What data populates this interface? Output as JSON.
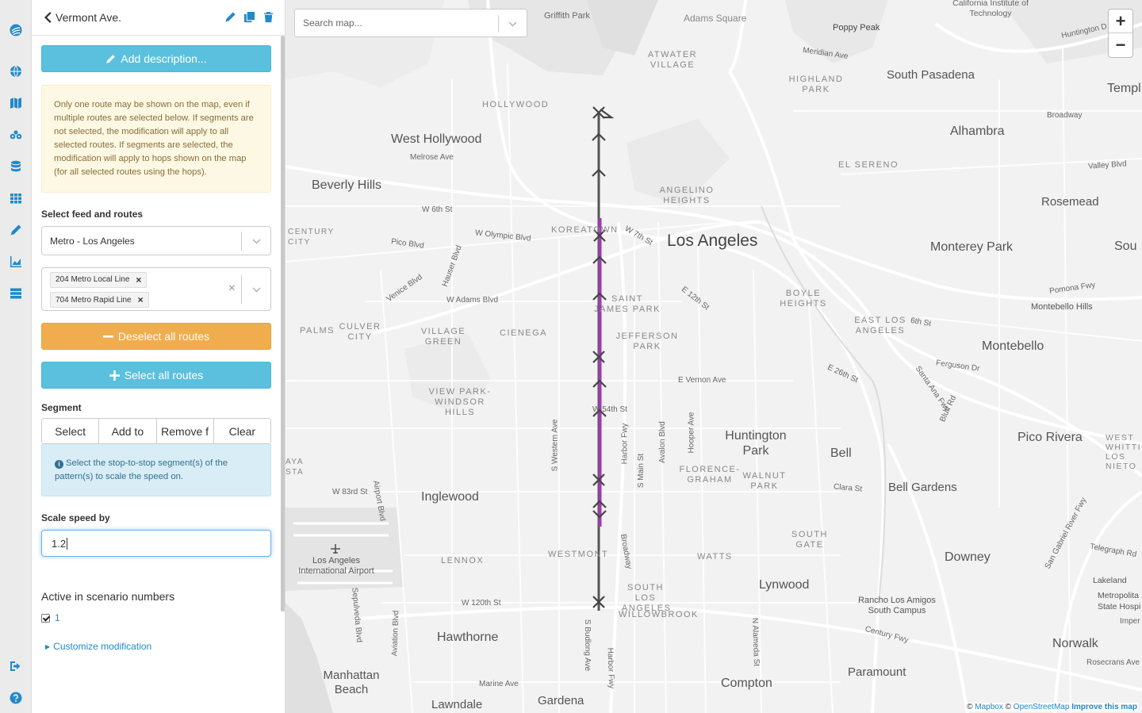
{
  "rail": {
    "icons": [
      "logo-icon",
      "globe-icon",
      "map-icon",
      "bike-network-icon",
      "database-icon",
      "grid-icon",
      "pencil-icon",
      "chart-icon",
      "server-icon",
      "logout-icon",
      "help-icon"
    ]
  },
  "panel": {
    "title": "Vermont Ave.",
    "add_description": "Add description...",
    "warning": "Only one route may be shown on the map, even if multiple routes are selected below. If segments are not selected, the modification will apply to all selected routes. If segments are selected, the modification will apply to hops shown on the map (for all selected routes using the hops).",
    "feed_label": "Select feed and routes",
    "feed_value": "Metro - Los Angeles",
    "routes": [
      "204 Metro Local Line",
      "704 Metro Rapid Line"
    ],
    "deselect_all": "Deselect all routes",
    "select_all": "Select all routes",
    "segment_label": "Segment",
    "segment_buttons": [
      "Select",
      "Add to",
      "Remove f",
      "Clear"
    ],
    "segment_help": "Select the stop-to-stop segment(s) of the pattern(s) to scale the speed on.",
    "scale_label": "Scale speed by",
    "scale_value": "1.2",
    "scenario_label": "Active in scenario numbers",
    "scenario_value": "1",
    "customize": "Customize modification"
  },
  "map": {
    "search_placeholder": "Search map...",
    "zoom_in": "+",
    "zoom_out": "−",
    "attribution": {
      "prefix": "©",
      "mapbox": "Mapbox",
      "sep": "©",
      "osm": "OpenStreetMap",
      "improve": "Improve this map"
    },
    "route_colors": {
      "base": "#555555",
      "selected": "#a03ab4"
    },
    "labels": {
      "griffith": "Griffith Park",
      "adams_square": "Adams Square",
      "caltech": "California Institute of Technology",
      "poppy_peak": "Poppy Peak",
      "huntington": "Huntington D",
      "meridian": "Meridian Ave",
      "atwater": "ATWATER VILLAGE",
      "highland": "HIGHLAND PARK",
      "south_pasadena": "South Pasadena",
      "temple": "Templ",
      "hollywood": "HOLLYWOOD",
      "broadway_ne": "Broadway",
      "west_hollywood": "West Hollywood",
      "melrose": "Melrose Ave",
      "alhambra": "Alhambra",
      "el_sereno": "EL SERENO",
      "valley_blvd": "Valley Blvd",
      "beverly_hills": "Beverly Hills",
      "angelino": "ANGELINO HEIGHTS",
      "rosemead": "Rosemead",
      "w6th": "W 6th St",
      "century_city": "CENTURY CITY",
      "pico": "Pico Blvd",
      "olympic": "W Olympic Blvd",
      "koreatown": "KOREATOWN",
      "w7th": "W 7th St",
      "los_angeles": "Los Angeles",
      "monterey_park": "Monterey Park",
      "sou": "Sou",
      "hauser": "Hauser Blvd",
      "venice": "Venice Blvd",
      "w_adams": "W Adams Blvd",
      "st_james": "SAINT JAMES PARK",
      "e12th": "E 12th St",
      "boyle": "BOYLE HEIGHTS",
      "pomona": "Pomona Fwy",
      "montebello_hills": "Montebello Hills",
      "palms": "PALMS",
      "culver": "CULVER CITY",
      "village_green": "VILLAGE GREEN",
      "cienega": "CIENEGA",
      "jefferson": "JEFFERSON PARK",
      "east_la": "EAST LOS ANGELES",
      "e6th": "6th St",
      "montebello": "Montebello",
      "e_vernon": "E Vernon Ave",
      "e26th": "E 26th St",
      "ferguson": "Ferguson Dr",
      "santa_ana": "Santa Ana Fwy",
      "view_park": "VIEW PARK-WINDSOR HILLS",
      "w54th": "W 54th St",
      "s_western": "S Western Ave",
      "harbor": "Harbor Fwy",
      "s_main": "S Main St",
      "avalon": "Avalon Blvd",
      "hooper": "Hooper Ave",
      "huntington_park": "Huntington Park",
      "bell": "Bell",
      "bluff": "Bluff Rd",
      "pico_rivera": "Pico Rivera",
      "west_whittier": "WEST WHITTIER LOS NIETO",
      "aya": "AYA STA",
      "w83rd": "W 83rd St",
      "airport_blvd": "Airport Blvd",
      "inglewood": "Inglewood",
      "florence": "FLORENCE-GRAHAM",
      "walnut_park": "WALNUT PARK",
      "clara": "Clara St",
      "bell_gardens": "Bell Gardens",
      "gw_river": "San Gabriel River Fwy",
      "lax": "Los Angeles International Airport",
      "westmont": "WESTMONT",
      "lennox": "LENNOX",
      "broadway_s": "Broadway",
      "watts": "WATTS",
      "south_gate": "SOUTH GATE",
      "downey": "Downey",
      "telegraph": "Telegraph Rd",
      "sepulveda": "Sepulveda Blvd",
      "aviation": "Aviation Blvd",
      "w120th": "W 120th St",
      "south_la": "SOUTH LOS ANGELES",
      "willowbrook": "WILLOWBROOK",
      "lynwood": "Lynwood",
      "rancho": "Rancho Los Amigos South Campus",
      "lakeland": "Lakeland",
      "metropolitan": "Metropolita State Hospi",
      "imper": "Imper",
      "hawthorne": "Hawthorne",
      "budlong": "S Budlong Ave",
      "harbor_fwy_s": "Harbor Fwy",
      "n_alameda": "N Alameda St",
      "century_fwy": "Century Fwy",
      "norwalk": "Norwalk",
      "rosecrans": "Rosecrans Ave",
      "manhattan": "Manhattan Beach",
      "marine": "Marine Ave",
      "paramount": "Paramount",
      "compton": "Compton",
      "lawndale": "Lawndale",
      "gardena": "Gardena"
    }
  }
}
